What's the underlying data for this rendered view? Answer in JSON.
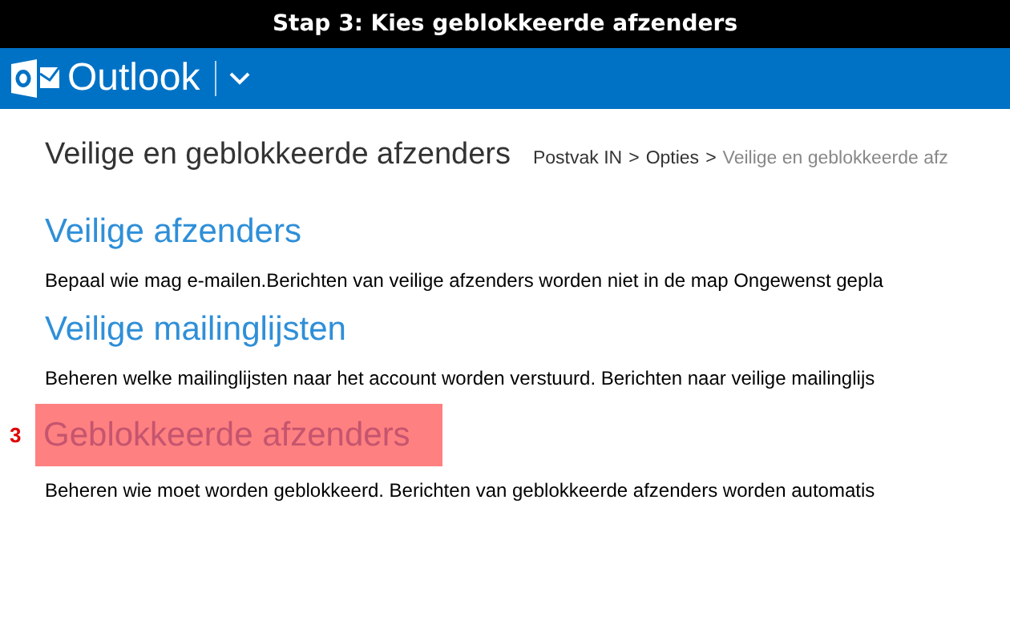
{
  "caption": "Stap 3: Kies geblokkeerde afzenders",
  "app_bar": {
    "brand": "Outlook"
  },
  "page_title": "Veilige en geblokkeerde afzenders",
  "breadcrumb": [
    {
      "label": "Postvak IN",
      "current": false
    },
    {
      "label": "Opties",
      "current": false
    },
    {
      "label": "Veilige en geblokkeerde afz",
      "current": true
    }
  ],
  "breadcrumb_separator": ">",
  "sections": [
    {
      "title": "Veilige afzenders",
      "description": "Bepaal wie mag e-mailen.Berichten van veilige afzenders worden niet in de map Ongewenst gepla",
      "highlighted": false
    },
    {
      "title": "Veilige mailinglijsten",
      "description": "Beheren welke mailinglijsten naar het account worden verstuurd. Berichten naar veilige mailinglijs",
      "highlighted": false
    },
    {
      "title": "Geblokkeerde afzenders",
      "description": "Beheren wie moet worden geblokkeerd. Berichten van geblokkeerde afzenders worden automatis",
      "highlighted": true,
      "marker": "3"
    }
  ]
}
